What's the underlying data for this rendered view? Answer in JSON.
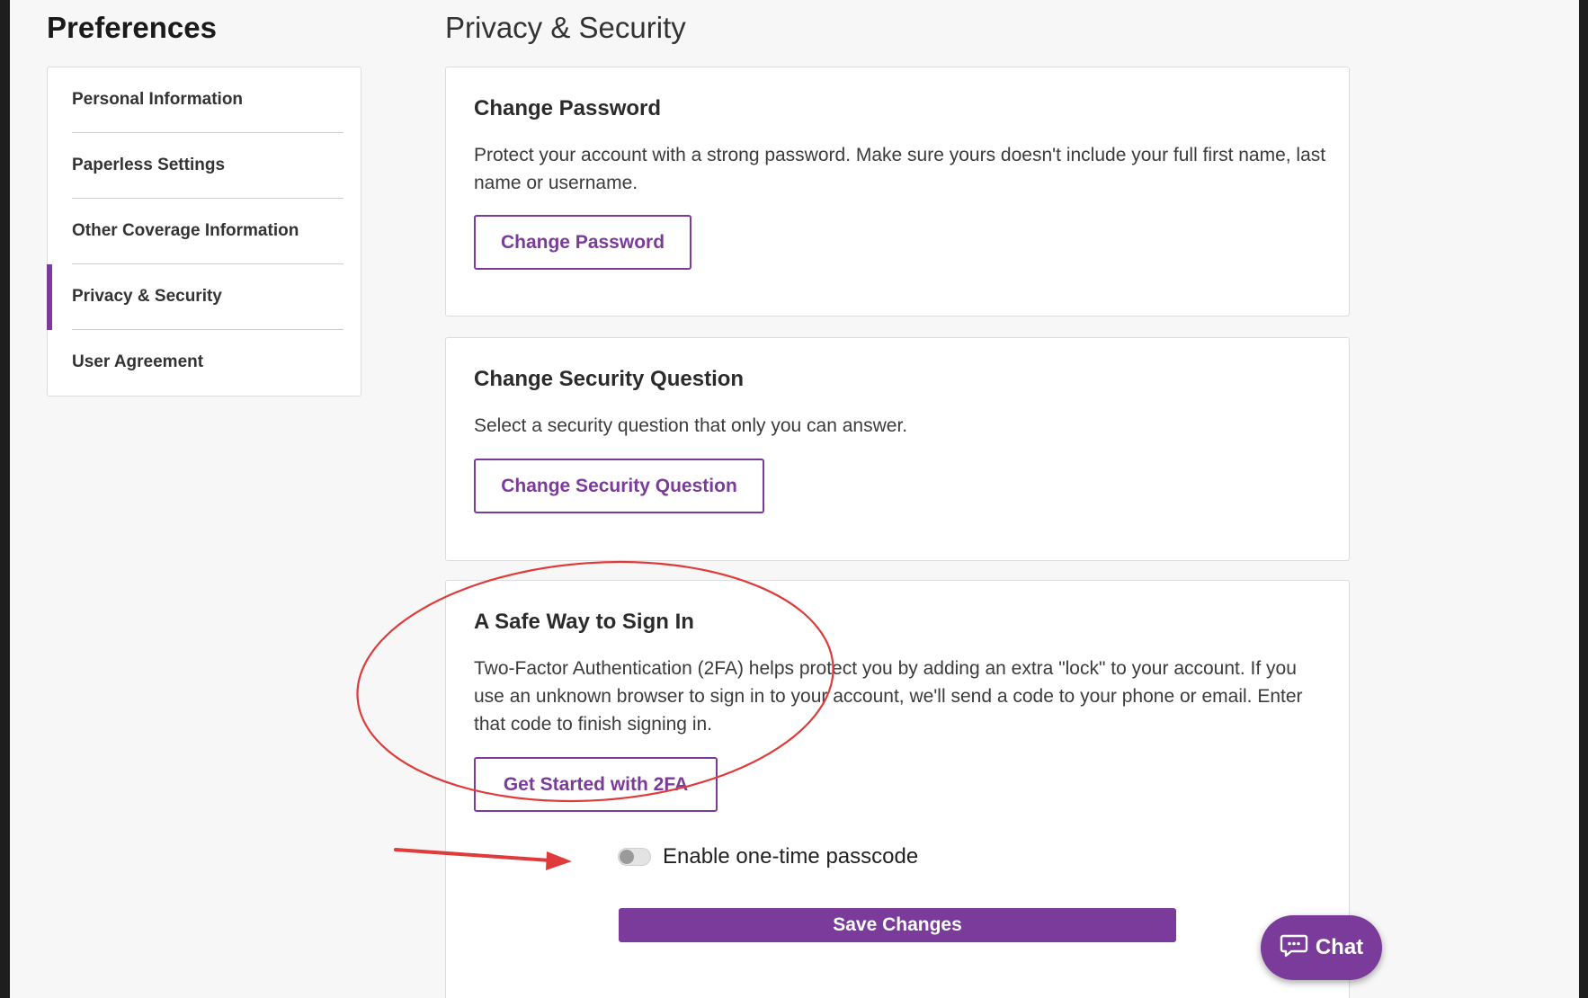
{
  "header": {
    "page_title": "Preferences",
    "section_title": "Privacy & Security"
  },
  "sidebar": {
    "items": [
      {
        "label": "Personal Information",
        "active": false
      },
      {
        "label": "Paperless Settings",
        "active": false
      },
      {
        "label": "Other Coverage Information",
        "active": false
      },
      {
        "label": "Privacy & Security",
        "active": true
      },
      {
        "label": "User Agreement",
        "active": false
      }
    ]
  },
  "cards": {
    "change_password": {
      "heading": "Change Password",
      "description": "Protect your account with a strong password. Make sure yours doesn't include your full first name, last name or username.",
      "button_label": "Change Password"
    },
    "security_question": {
      "heading": "Change Security Question",
      "description": "Select a security question that only you can answer.",
      "button_label": "Change Security Question"
    },
    "two_factor": {
      "heading": "A Safe Way to Sign In",
      "description": "Two-Factor Authentication (2FA) helps protect you by adding an extra \"lock\" to your account. If you use an unknown browser to sign in to your account, we'll send a code to your phone or email. Enter that code to finish signing in.",
      "button_label": "Get Started with 2FA",
      "toggle_label": "Enable one-time passcode",
      "toggle_on": false,
      "save_label": "Save Changes"
    }
  },
  "chat": {
    "label": "Chat",
    "icon": "chat-bubble-icon"
  },
  "colors": {
    "accent": "#7b3b9a",
    "annotation": "#e03b3b",
    "background": "#f7f7f7"
  }
}
